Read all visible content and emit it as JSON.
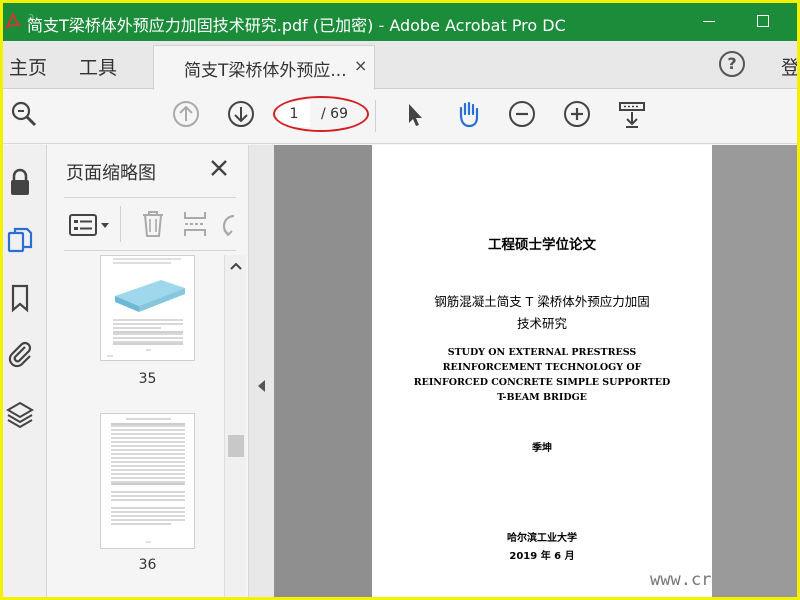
{
  "window": {
    "title": "简支T梁桥体外预应力加固技术研究.pdf (已加密) - Adobe Acrobat Pro DC"
  },
  "menu": {
    "home": "主页",
    "tools": "工具",
    "doc_tab_label": "简支T梁桥体外预应...",
    "doc_tab_close": "×",
    "login": "登"
  },
  "toolbar": {
    "current_page": "1",
    "total_pages": "/ 69"
  },
  "thumbnail_panel": {
    "title": "页面缩略图",
    "thumbs": [
      {
        "number": "35"
      },
      {
        "number": "36"
      }
    ]
  },
  "document": {
    "heading": "工程硕士学位论文",
    "title_zh_line1": "钢筋混凝土简支 T 梁桥体外预应力加固",
    "title_zh_line2": "技术研究",
    "title_en_line1": "STUDY ON EXTERNAL PRESTRESS",
    "title_en_line2": "REINFORCEMENT TECHNOLOGY OF",
    "title_en_line3": "REINFORCED CONCRETE SIMPLE SUPPORTED",
    "title_en_line4": "T-BEAM BRIDGE",
    "author": "季坤",
    "university": "哈尔滨工业大学",
    "date": "2019 年 6 月"
  },
  "watermark": "www.cr",
  "colors": {
    "titlebar": "#1a8c3a",
    "annotation_circle": "#d42020",
    "frame_border": "#f2f200",
    "document_bg": "#8f8f8f"
  }
}
